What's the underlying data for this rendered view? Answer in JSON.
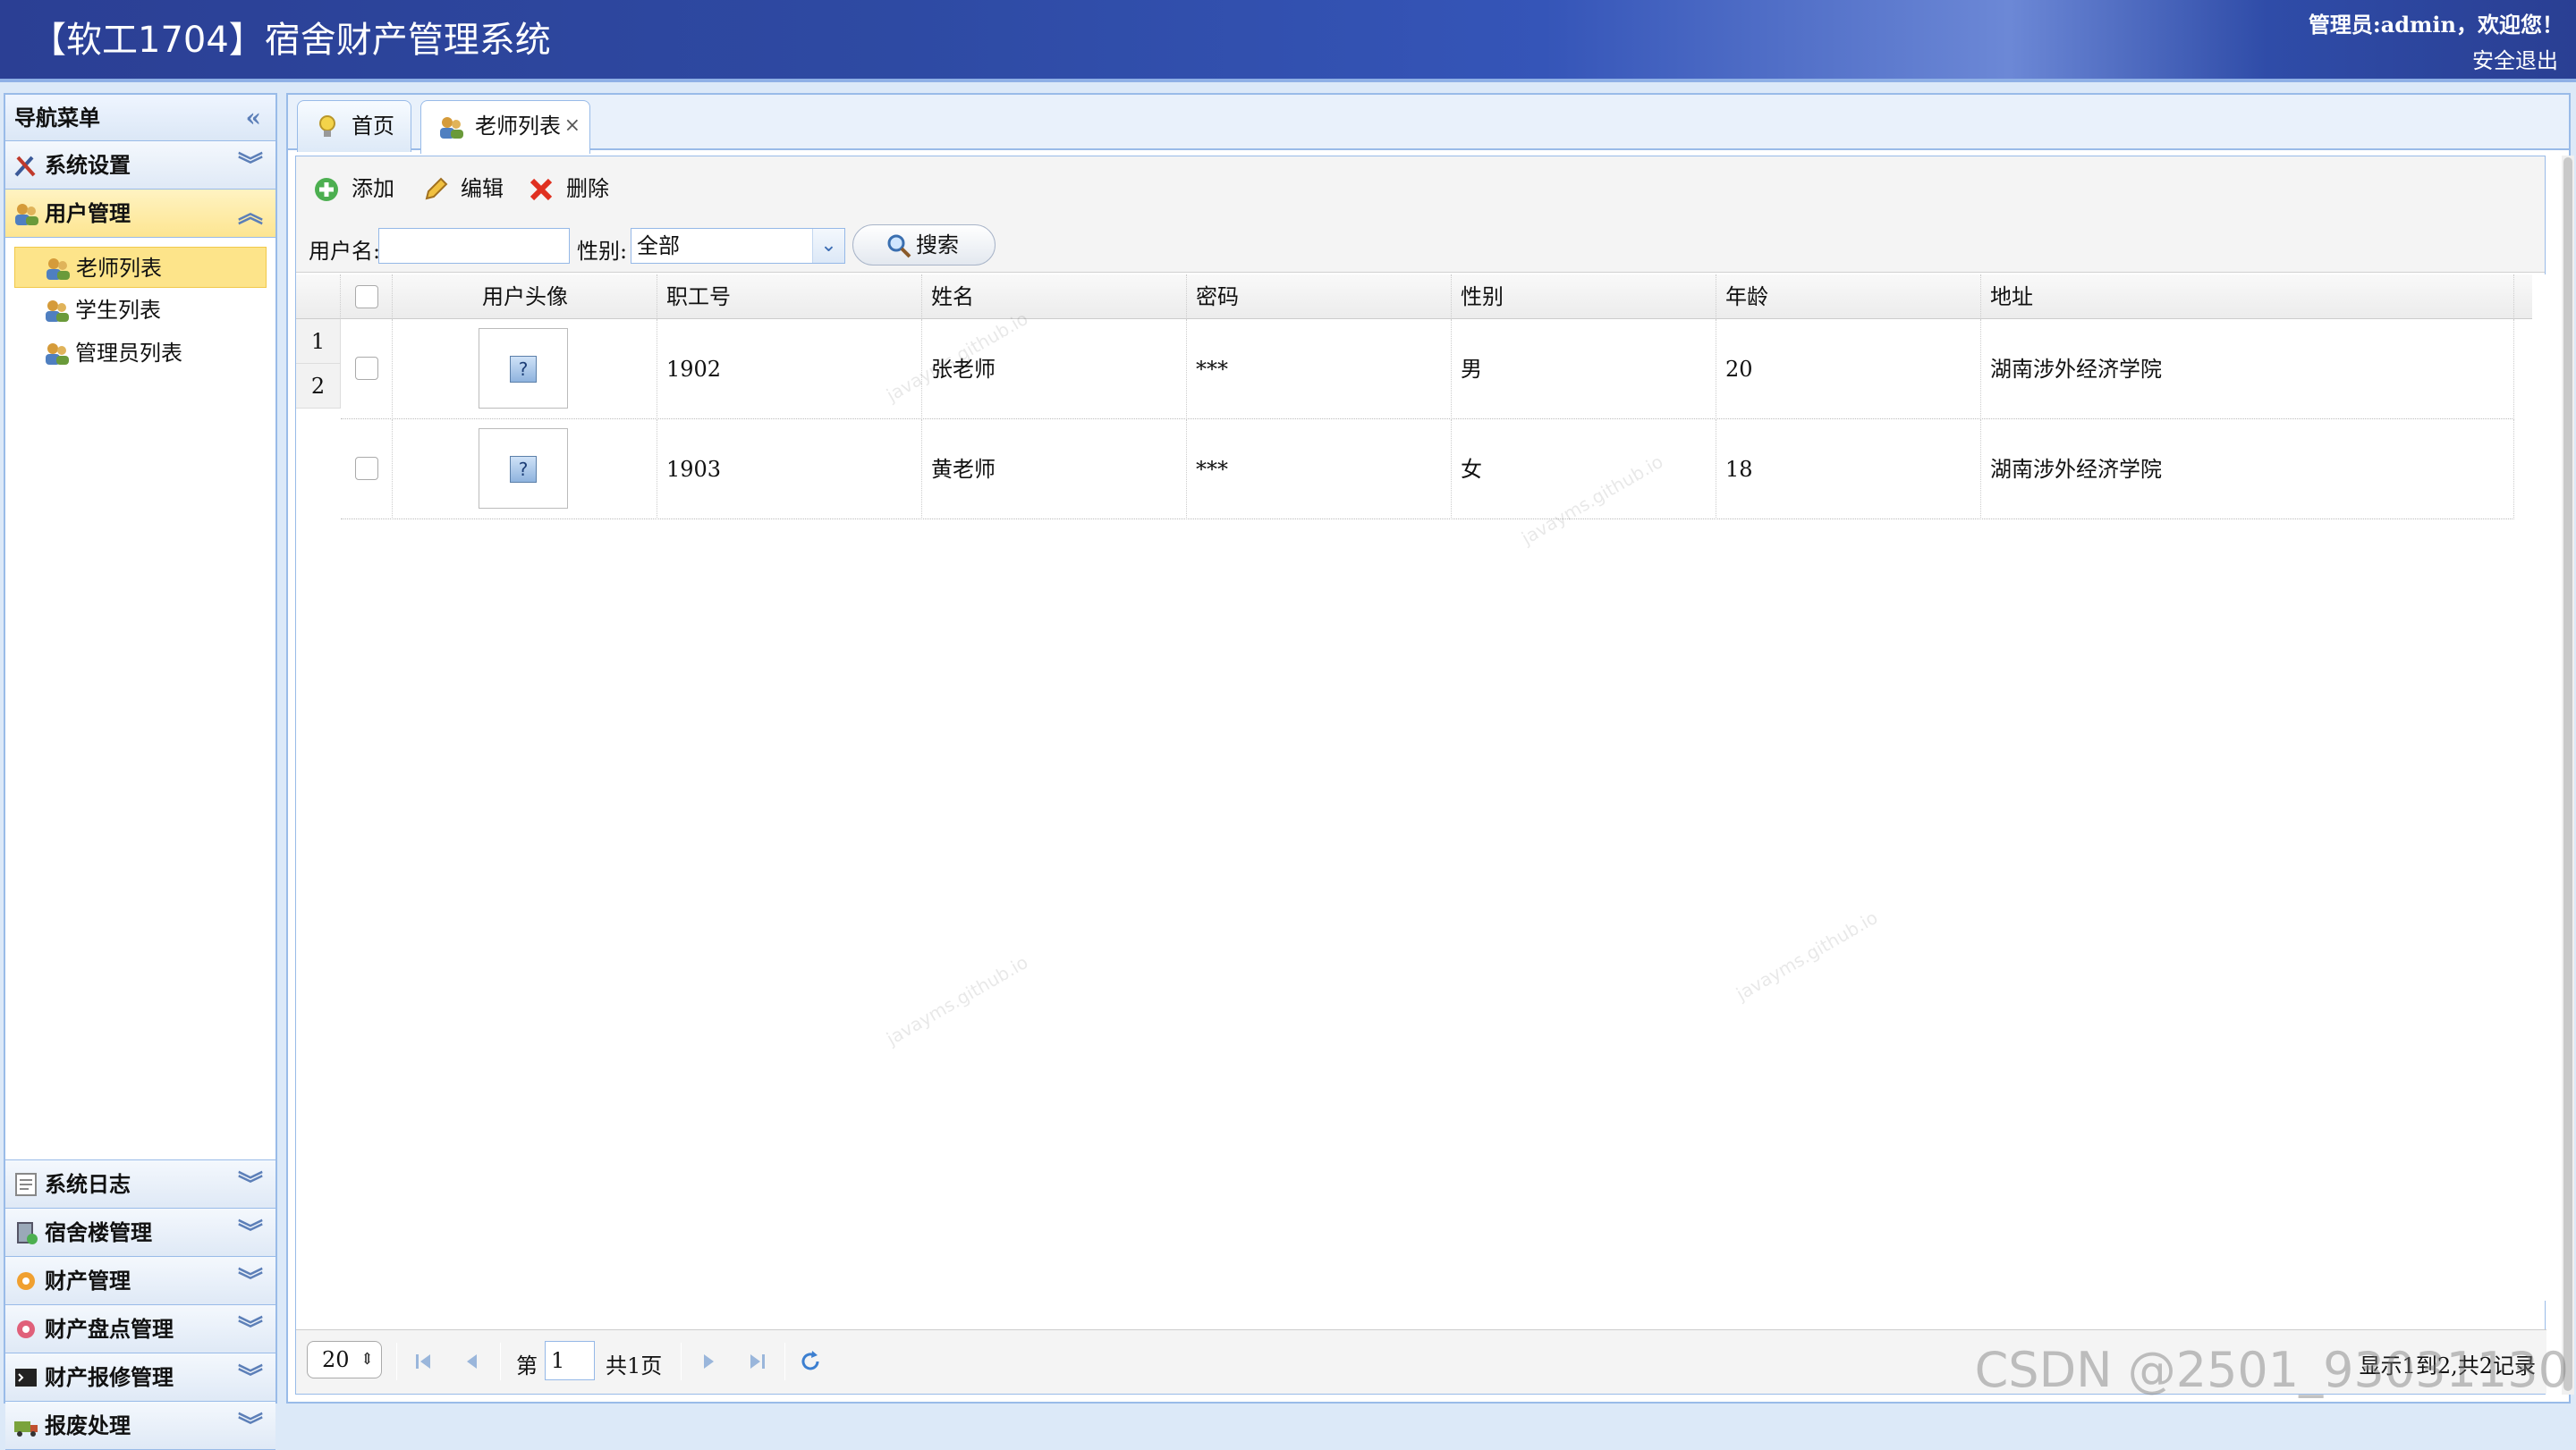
{
  "header": {
    "title": "【软工1704】宿舍财产管理系统",
    "welcome": "管理员:admin，欢迎您！",
    "logout": "安全退出"
  },
  "sidebar": {
    "title": "导航菜单",
    "sections": [
      {
        "label": "系统设置",
        "icon": "tools-icon"
      },
      {
        "label": "用户管理",
        "icon": "users-icon"
      },
      {
        "label": "系统日志",
        "icon": "log-icon"
      },
      {
        "label": "宿舍楼管理",
        "icon": "building-icon"
      },
      {
        "label": "财产管理",
        "icon": "gear-icon"
      },
      {
        "label": "财产盘点管理",
        "icon": "gear-pink-icon"
      },
      {
        "label": "财产报修管理",
        "icon": "terminal-icon"
      },
      {
        "label": "报废处理",
        "icon": "truck-icon"
      }
    ],
    "user_items": [
      {
        "label": "老师列表"
      },
      {
        "label": "学生列表"
      },
      {
        "label": "管理员列表"
      }
    ]
  },
  "tabs": [
    {
      "label": "首页"
    },
    {
      "label": "老师列表",
      "close": "×"
    }
  ],
  "toolbar": {
    "add": "添加",
    "edit": "编辑",
    "delete": "删除"
  },
  "search": {
    "username_label": "用户名:",
    "username_value": "",
    "gender_label": "性别:",
    "gender_value": "全部",
    "search_button": "搜索"
  },
  "grid": {
    "columns": [
      "用户头像",
      "职工号",
      "姓名",
      "密码",
      "性别",
      "年龄",
      "地址"
    ],
    "row_numbers": [
      "1",
      "2"
    ],
    "rows": [
      {
        "avatar": "?",
        "staff_no": "1902",
        "name": "张老师",
        "password": "***",
        "gender": "男",
        "age": "20",
        "address": "湖南涉外经济学院"
      },
      {
        "avatar": "?",
        "staff_no": "1903",
        "name": "黄老师",
        "password": "***",
        "gender": "女",
        "age": "18",
        "address": "湖南涉外经济学院"
      }
    ]
  },
  "pager": {
    "page_size": "20",
    "page_prefix": "第",
    "current_page": "1",
    "total_pages": "共1页",
    "info": "显示1到2,共2记录"
  },
  "watermarks": [
    "javayms.github.io",
    "javayms.github.io",
    "javayms.github.io",
    "javayms.github.io"
  ],
  "footer_watermark": "CSDN @2501_93031130"
}
